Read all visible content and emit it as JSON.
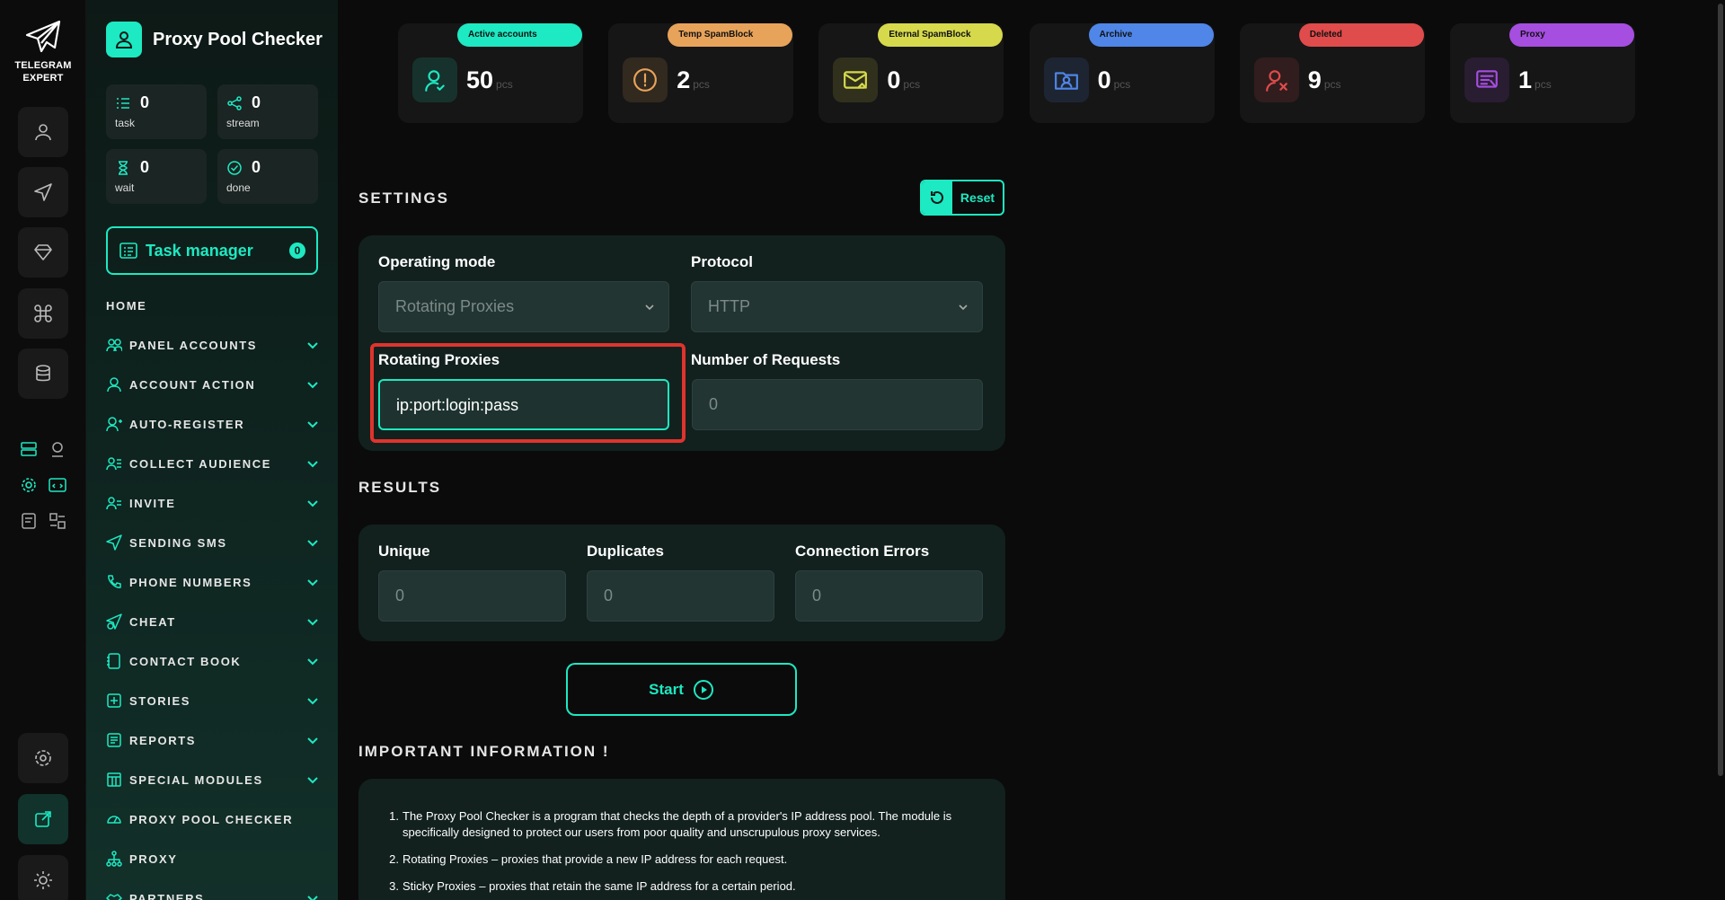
{
  "app": {
    "logo_line1": "TELEGRAM",
    "logo_line2": "EXPERT",
    "title": "Proxy Pool Checker"
  },
  "stats": [
    {
      "value": "0",
      "label": "task",
      "icon": "list-icon"
    },
    {
      "value": "0",
      "label": "stream",
      "icon": "share-icon"
    },
    {
      "value": "0",
      "label": "wait",
      "icon": "hourglass-icon"
    },
    {
      "value": "0",
      "label": "done",
      "icon": "check-circle-icon"
    }
  ],
  "task_manager": {
    "label": "Task manager",
    "count": "0"
  },
  "nav": {
    "home": "HOME",
    "items": [
      {
        "label": "PANEL ACCOUNTS",
        "icon": "users-icon",
        "chevron": true
      },
      {
        "label": "ACCOUNT ACTION",
        "icon": "user-icon",
        "chevron": true
      },
      {
        "label": "AUTO-REGISTER",
        "icon": "user-plus-icon",
        "chevron": true
      },
      {
        "label": "COLLECT AUDIENCE",
        "icon": "user-group-icon",
        "chevron": true
      },
      {
        "label": "INVITE",
        "icon": "user-invite-icon",
        "chevron": true
      },
      {
        "label": "SENDING SMS",
        "icon": "send-icon",
        "chevron": true
      },
      {
        "label": "PHONE NUMBERS",
        "icon": "phone-icon",
        "chevron": true
      },
      {
        "label": "CHEAT",
        "icon": "cheat-icon",
        "chevron": true
      },
      {
        "label": "CONTACT BOOK",
        "icon": "book-icon",
        "chevron": true
      },
      {
        "label": "STORIES",
        "icon": "plus-square-icon",
        "chevron": true
      },
      {
        "label": "REPORTS",
        "icon": "report-icon",
        "chevron": true
      },
      {
        "label": "SPECIAL MODULES",
        "icon": "modules-icon",
        "chevron": true
      },
      {
        "label": "PROXY POOL CHECKER",
        "icon": "gauge-icon",
        "chevron": false
      },
      {
        "label": "PROXY",
        "icon": "network-icon",
        "chevron": false
      },
      {
        "label": "PARTNERS",
        "icon": "handshake-icon",
        "chevron": true
      }
    ]
  },
  "cards": [
    {
      "label": "Active accounts",
      "value": "50",
      "unit": "pcs",
      "color": "#1de9c2",
      "icon": "user-active-icon"
    },
    {
      "label": "Temp SpamBlock",
      "value": "2",
      "unit": "pcs",
      "color": "#e8a35a",
      "icon": "warning-icon"
    },
    {
      "label": "Eternal SpamBlock",
      "value": "0",
      "unit": "pcs",
      "color": "#d6d94c",
      "icon": "mail-block-icon"
    },
    {
      "label": "Archive",
      "value": "0",
      "unit": "pcs",
      "color": "#4f86e8",
      "icon": "archive-folder-icon"
    },
    {
      "label": "Deleted",
      "value": "9",
      "unit": "pcs",
      "color": "#e04b4b",
      "icon": "user-deleted-icon"
    },
    {
      "label": "Proxy",
      "value": "1",
      "unit": "pcs",
      "color": "#a64ee0",
      "icon": "proxy-icon"
    }
  ],
  "settings": {
    "title": "SETTINGS",
    "reset_label": "Reset",
    "operating_mode_label": "Operating mode",
    "operating_mode_value": "Rotating Proxies",
    "protocol_label": "Protocol",
    "protocol_value": "HTTP",
    "rotating_label": "Rotating Proxies",
    "rotating_value": "ip:port:login:pass",
    "requests_label": "Number of Requests",
    "requests_placeholder": "0"
  },
  "results": {
    "title": "RESULTS",
    "unique_label": "Unique",
    "unique_placeholder": "0",
    "duplicates_label": "Duplicates",
    "duplicates_placeholder": "0",
    "errors_label": "Connection Errors",
    "errors_placeholder": "0"
  },
  "start_label": "Start",
  "info": {
    "title": "IMPORTANT INFORMATION !",
    "items": [
      {
        "num": "1.",
        "text": "The Proxy Pool Checker is a program that checks the depth of a provider's IP address pool. The module is specifically designed to protect our users from poor quality and unscrupulous proxy services."
      },
      {
        "num": "2.",
        "text": "Rotating Proxies – proxies that provide a new IP address for each request."
      },
      {
        "num": "3.",
        "text": "Sticky Proxies – proxies that retain the same IP address for a certain period."
      }
    ]
  },
  "colors": {
    "accent": "#1de9c2",
    "highlight": "#e0332d"
  }
}
